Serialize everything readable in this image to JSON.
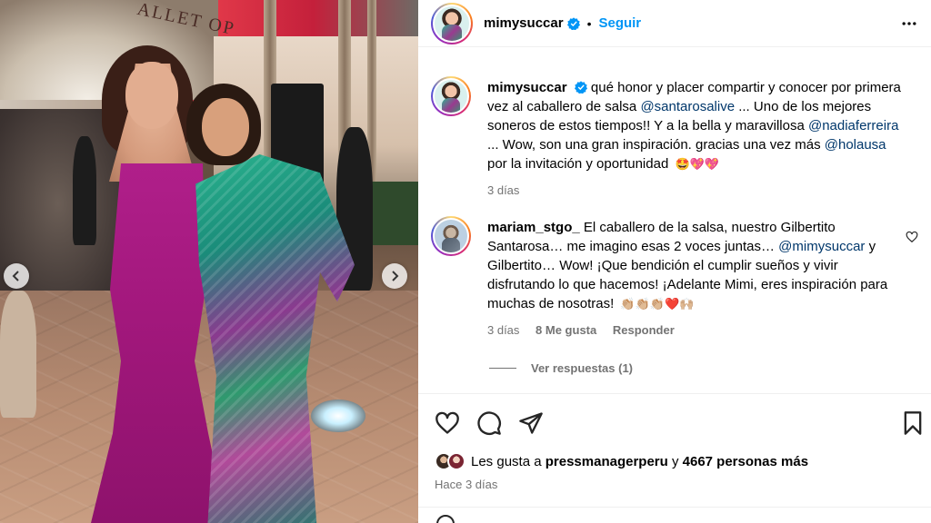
{
  "photo": {
    "sign_text": "ALLET OP",
    "prev_icon": "chevron-left-icon",
    "next_icon": "chevron-right-icon"
  },
  "post": {
    "author": "mimysuccar",
    "verified": true,
    "separator": "•",
    "follow_label": "Seguir",
    "more_icon": "more-horizontal-icon"
  },
  "caption": {
    "username": "mimysuccar",
    "text_1": "qué honor y placer compartir y conocer por primera vez al caballero de salsa",
    "mention_1": "@santarosalive",
    "text_2": "... Uno de los mejores soneros de estos tiempos!! Y a la bella y maravillosa",
    "mention_2": "@nadiaferreira",
    "text_3": "... Wow, son una gran inspiración. gracias una vez más",
    "mention_3": "@holausa",
    "text_4": "por la invitación y oportunidad",
    "emojis": "🤩💖💖",
    "time": "3 días"
  },
  "comment": {
    "username": "mariam_stgo_",
    "text_1": "El caballero de la salsa, nuestro Gilbertito Santarosa… me imagino esas 2 voces juntas…",
    "mention": "@mimysuccar",
    "text_2": "y Gilbertito… Wow! ¡Que bendición el cumplir sueños y vivir disfrutando lo que hacemos! ¡Adelante Mimi, eres inspiración para muchas de nosotras!",
    "emojis": "👏🏼👏🏼👏🏼❤️🙌🏼",
    "time": "3 días",
    "likes": "8 Me gusta",
    "reply_label": "Responder",
    "view_replies": "Ver respuestas (1)"
  },
  "actions": {
    "like_icon": "heart-icon",
    "comment_icon": "comment-icon",
    "share_icon": "send-icon",
    "save_icon": "bookmark-icon"
  },
  "likes": {
    "prefix": "Les gusta a",
    "user": "pressmanagerperu",
    "conj": "y",
    "others": "4667 personas más"
  },
  "posted_ago": "Hace 3 días",
  "colors": {
    "link_blue": "#0095f6",
    "mention_blue": "#00376b",
    "muted": "#737373",
    "verified_blue": "#0095f6"
  }
}
